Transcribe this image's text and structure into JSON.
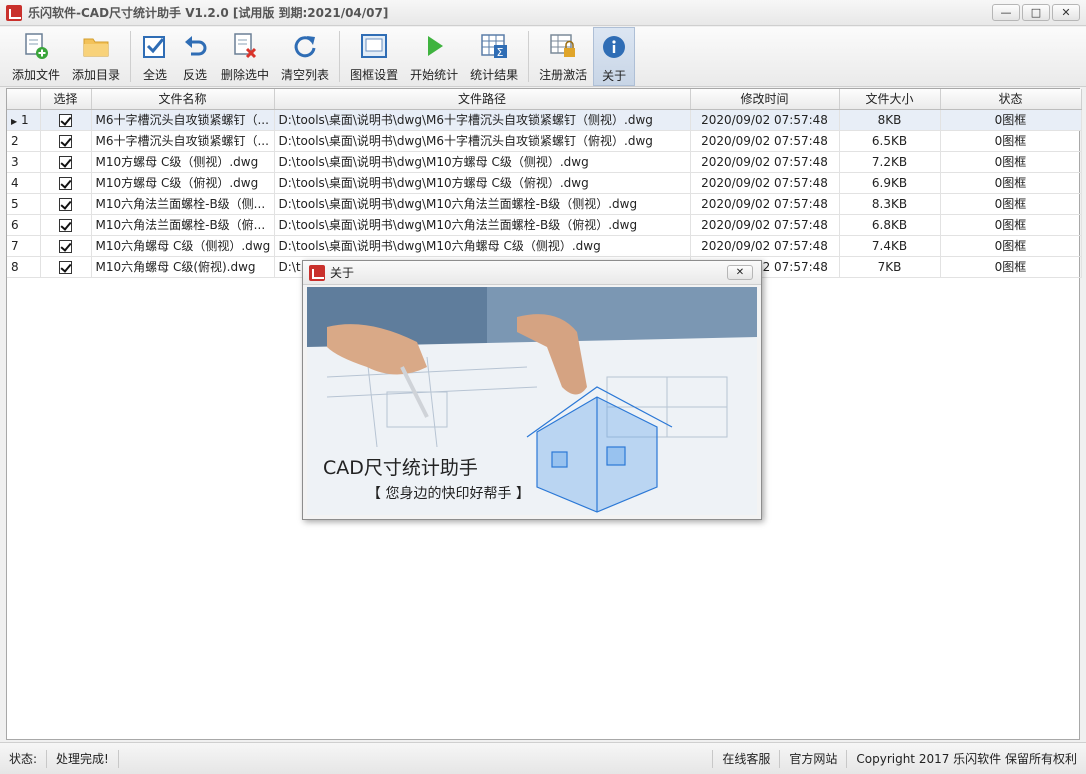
{
  "titlebar": {
    "title": "乐闪软件-CAD尺寸统计助手 V1.2.0 [试用版 到期:2021/04/07]",
    "min_label": "—",
    "max_label": "□",
    "close_label": "✕"
  },
  "toolbar": {
    "add_file": "添加文件",
    "add_dir": "添加目录",
    "select_all": "全选",
    "invert": "反选",
    "delete_selected": "删除选中",
    "clear_list": "清空列表",
    "frame_settings": "图框设置",
    "start_stats": "开始统计",
    "stats_result": "统计结果",
    "register": "注册激活",
    "about": "关于"
  },
  "table": {
    "headers": [
      "选择",
      "文件名称",
      "文件路径",
      "修改时间",
      "文件大小",
      "状态"
    ],
    "rows": [
      {
        "idx": "1",
        "name": "M6十字槽沉头自攻锁紧螺钉（...",
        "path": "D:\\tools\\桌面\\说明书\\dwg\\M6十字槽沉头自攻锁紧螺钉（侧视）.dwg",
        "time": "2020/09/02 07:57:48",
        "size": "8KB",
        "status": "0图框"
      },
      {
        "idx": "2",
        "name": "M6十字槽沉头自攻锁紧螺钉（...",
        "path": "D:\\tools\\桌面\\说明书\\dwg\\M6十字槽沉头自攻锁紧螺钉（俯视）.dwg",
        "time": "2020/09/02 07:57:48",
        "size": "6.5KB",
        "status": "0图框"
      },
      {
        "idx": "3",
        "name": "M10方螺母 C级（侧视）.dwg",
        "path": "D:\\tools\\桌面\\说明书\\dwg\\M10方螺母 C级（侧视）.dwg",
        "time": "2020/09/02 07:57:48",
        "size": "7.2KB",
        "status": "0图框"
      },
      {
        "idx": "4",
        "name": "M10方螺母 C级（俯视）.dwg",
        "path": "D:\\tools\\桌面\\说明书\\dwg\\M10方螺母 C级（俯视）.dwg",
        "time": "2020/09/02 07:57:48",
        "size": "6.9KB",
        "status": "0图框"
      },
      {
        "idx": "5",
        "name": "M10六角法兰面螺栓-B级（侧...",
        "path": "D:\\tools\\桌面\\说明书\\dwg\\M10六角法兰面螺栓-B级（侧视）.dwg",
        "time": "2020/09/02 07:57:48",
        "size": "8.3KB",
        "status": "0图框"
      },
      {
        "idx": "6",
        "name": "M10六角法兰面螺栓-B级（俯...",
        "path": "D:\\tools\\桌面\\说明书\\dwg\\M10六角法兰面螺栓-B级（俯视）.dwg",
        "time": "2020/09/02 07:57:48",
        "size": "6.8KB",
        "status": "0图框"
      },
      {
        "idx": "7",
        "name": "M10六角螺母 C级（侧视）.dwg",
        "path": "D:\\tools\\桌面\\说明书\\dwg\\M10六角螺母 C级（侧视）.dwg",
        "time": "2020/09/02 07:57:48",
        "size": "7.4KB",
        "status": "0图框"
      },
      {
        "idx": "8",
        "name": "M10六角螺母 C级(俯视).dwg",
        "path": "D:\\t",
        "time": "2020/09/02 07:57:48",
        "size": "7KB",
        "status": "0图框"
      }
    ]
  },
  "statusbar": {
    "label": "状态:",
    "message": "处理完成!",
    "online_service": "在线客服",
    "website": "官方网站",
    "copyright": "Copyright 2017 乐闪软件 保留所有权利"
  },
  "about_dialog": {
    "title": "关于",
    "close_label": "✕",
    "app_name": "CAD尺寸统计助手",
    "slogan": "【 您身边的快印好帮手 】"
  },
  "colors": {
    "accent_blue": "#2f6db5",
    "brand_red": "#c9302c"
  }
}
